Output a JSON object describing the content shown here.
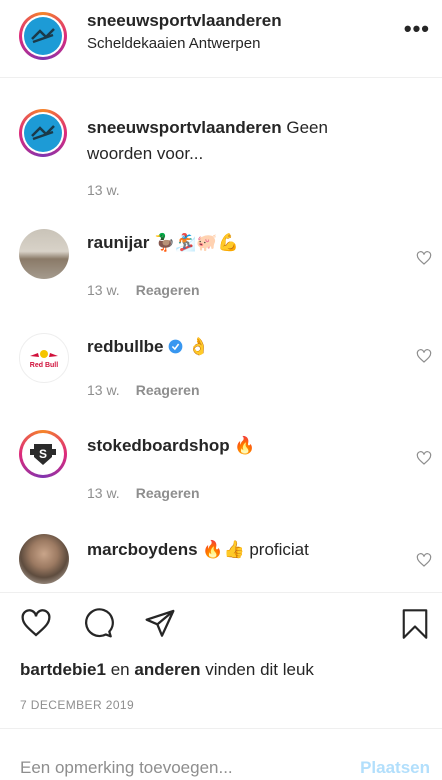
{
  "header": {
    "username": "sneeuwsportvlaanderen",
    "location": "Scheldekaaien Antwerpen",
    "more_label": "•••"
  },
  "caption": {
    "username": "sneeuwsportvlaanderen",
    "text": "Geen woorden voor...",
    "time": "13 w."
  },
  "comments": [
    {
      "username": "raunijar",
      "text": "🦆🏂🐖💪",
      "time": "13 w.",
      "reply": "Reageren"
    },
    {
      "username": "redbullbe",
      "text": "👌",
      "time": "13 w.",
      "reply": "Reageren"
    },
    {
      "username": "stokedboardshop",
      "text": "🔥",
      "time": "13 w.",
      "reply": "Reageren"
    },
    {
      "username": "marcboydens",
      "text": "🔥👍 proficiat"
    }
  ],
  "likes": {
    "user": "bartdebie1",
    "connector": "en",
    "others": "anderen",
    "suffix": "vinden dit leuk"
  },
  "date": "7 DECEMBER 2019",
  "add_comment": {
    "placeholder": "Een opmerking toevoegen...",
    "post_label": "Plaatsen"
  },
  "colors": {
    "brand_blue": "#1d9bd6",
    "muted": "#8e8e8e",
    "post_disabled": "#b2dffc"
  }
}
